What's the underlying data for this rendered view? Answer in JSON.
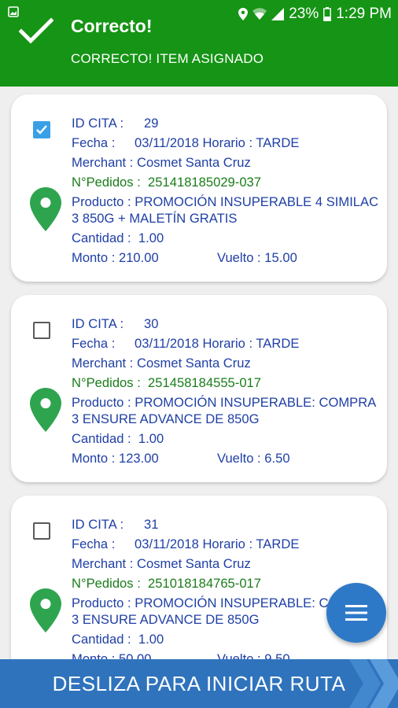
{
  "status_bar": {
    "battery": "23%",
    "time": "1:29 PM"
  },
  "header": {
    "title": "Correcto!",
    "subtitle": "CORRECTO! ITEM ASIGNADO",
    "bg_color": "#159415"
  },
  "labels": {
    "id_cita": "ID CITA :",
    "fecha": "Fecha :",
    "horario": "Horario :",
    "merchant": "Merchant :",
    "pedidos": "N°Pedidos :",
    "producto": "Producto :",
    "cantidad": "Cantidad :",
    "monto": "Monto :",
    "vuelto": "Vuelto :"
  },
  "items": [
    {
      "checked": true,
      "id_cita": "29",
      "fecha": "03/11/2018",
      "horario": "TARDE",
      "merchant": "Cosmet Santa Cruz",
      "pedidos": "251418185029-037",
      "producto": "PROMOCIÓN INSUPERABLE  4 SIMILAC 3 850G + MALETÍN GRATIS",
      "cantidad": "1.00",
      "monto": "210.00",
      "vuelto": "15.00"
    },
    {
      "checked": false,
      "id_cita": "30",
      "fecha": "03/11/2018",
      "horario": "TARDE",
      "merchant": "Cosmet Santa Cruz",
      "pedidos": "251458184555-017",
      "producto": "PROMOCIÓN INSUPERABLE: COMPRA 3 ENSURE ADVANCE DE 850G",
      "cantidad": "1.00",
      "monto": "123.00",
      "vuelto": "6.50"
    },
    {
      "checked": false,
      "id_cita": "31",
      "fecha": "03/11/2018",
      "horario": "TARDE",
      "merchant": "Cosmet Santa Cruz",
      "pedidos": "251018184765-017",
      "producto": "PROMOCIÓN INSUPERABLE: COMPRA 3 ENSURE ADVANCE DE 850G",
      "cantidad": "1.00",
      "monto": "50.00",
      "vuelto": "9.50"
    }
  ],
  "bottom_bar": {
    "label": "DESLIZA PARA INICIAR RUTA"
  },
  "icons": {
    "header": "check-icon",
    "fab": "menu-icon",
    "card": "location-pin-icon"
  },
  "colors": {
    "pin": "#2ea44f",
    "checkbox_checked": "#3aa0e6",
    "fab": "#2e79c7",
    "bottom_bar": "#2f73bd"
  }
}
